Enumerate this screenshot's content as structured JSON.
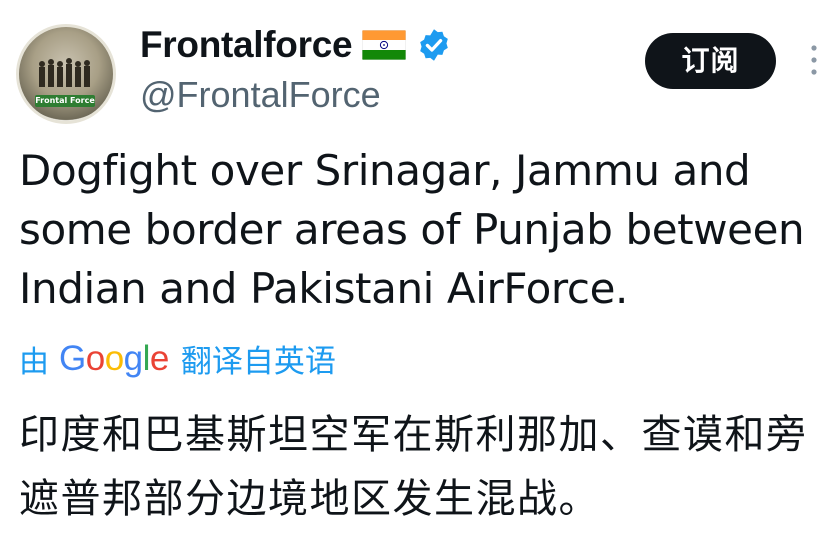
{
  "author": {
    "display_name": "Frontalforce",
    "handle": "@FrontalForce",
    "avatar_label": "Frontal Force",
    "flag_icon": "india-flag-icon",
    "verified_icon": "verified-badge-icon",
    "verified_color": "#1d9bf0"
  },
  "subscribe_button": {
    "label": "订阅"
  },
  "more_icon": "more-vertical-icon",
  "tweet": {
    "text": "Dogfight over Srinagar, Jammu and some border areas of Punjab between Indian and Pakistani AirForce."
  },
  "translation": {
    "by_label": "由",
    "google_logo": "Google",
    "action_label": "翻译自英语",
    "link_color": "#1d9bf0",
    "translated_text": "印度和巴基斯坦空军在斯利那加、查谟和旁遮普邦部分边境地区发生混战。"
  }
}
